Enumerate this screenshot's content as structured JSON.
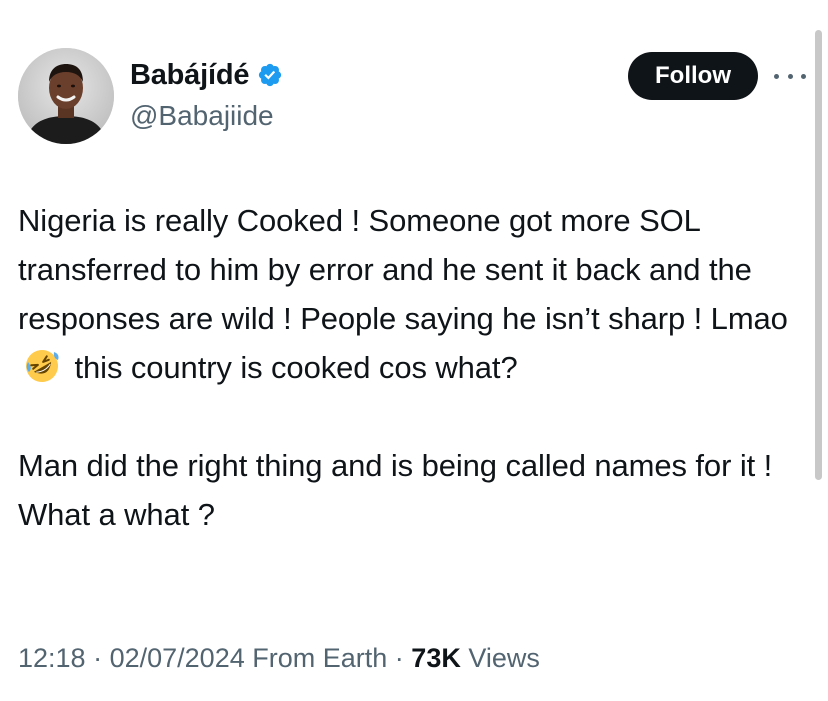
{
  "author": {
    "display_name": "Babájídé",
    "handle": "@Babajiide",
    "verified": true,
    "avatar_icon": "profile-photo"
  },
  "actions": {
    "follow_label": "Follow",
    "more_icon": "ellipsis-icon"
  },
  "tweet": {
    "paragraph1_part1": "Nigeria is really Cooked ! Someone got more SOL transferred to him by error and he sent it back and the responses are wild ! People saying he isn’t sharp ! Lmao",
    "paragraph1_emoji": "rolling-on-floor-laughing-emoji",
    "paragraph1_part2": "this country is cooked cos what?",
    "paragraph2": "Man did the right thing and is being called names for it ! What a what ?"
  },
  "meta": {
    "time": "12:18",
    "date": "02/07/2024",
    "source": "From Earth",
    "views_count": "73K",
    "views_label": "Views"
  },
  "colors": {
    "text": "#0f1419",
    "secondary": "#536471",
    "verified_badge": "#1d9bf0",
    "follow_bg": "#0f1419"
  }
}
